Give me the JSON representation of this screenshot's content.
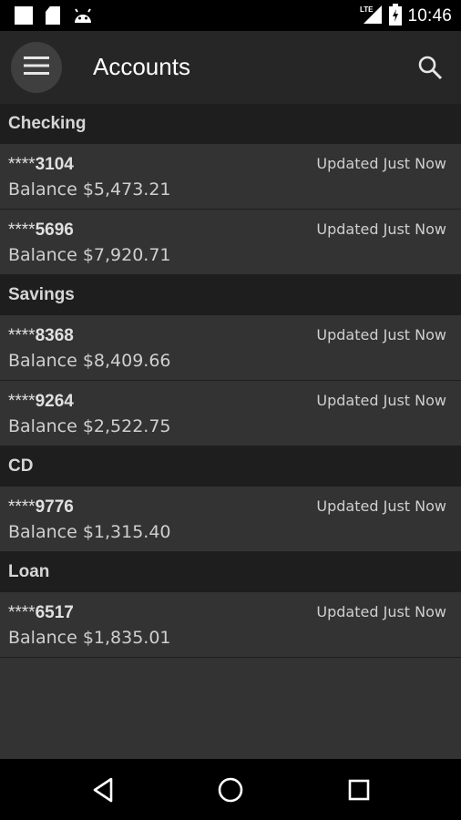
{
  "status_bar": {
    "network": "LTE",
    "time": "10:46"
  },
  "app_bar": {
    "title": "Accounts",
    "menu_icon": "hamburger-menu-icon",
    "search_icon": "search-icon"
  },
  "sections": [
    {
      "title": "Checking",
      "accounts": [
        {
          "mask": "****",
          "last4": "3104",
          "balance": "Balance $5,473.21",
          "updated": "Updated Just Now"
        },
        {
          "mask": "****",
          "last4": "5696",
          "balance": "Balance $7,920.71",
          "updated": "Updated Just Now"
        }
      ]
    },
    {
      "title": "Savings",
      "accounts": [
        {
          "mask": "****",
          "last4": "8368",
          "balance": "Balance $8,409.66",
          "updated": "Updated Just Now"
        },
        {
          "mask": "****",
          "last4": "9264",
          "balance": "Balance $2,522.75",
          "updated": "Updated Just Now"
        }
      ]
    },
    {
      "title": "CD",
      "accounts": [
        {
          "mask": "****",
          "last4": "9776",
          "balance": "Balance $1,315.40",
          "updated": "Updated Just Now"
        }
      ]
    },
    {
      "title": "Loan",
      "accounts": [
        {
          "mask": "****",
          "last4": "6517",
          "balance": "Balance $1,835.01",
          "updated": "Updated Just Now"
        }
      ]
    }
  ],
  "nav_bar": {
    "back_icon": "back-triangle-icon",
    "home_icon": "home-circle-icon",
    "recents_icon": "recents-square-icon"
  },
  "colors": {
    "background": "#333333",
    "section_header": "#1e1e1e",
    "app_bar": "#262626",
    "status_bar": "#000000"
  }
}
